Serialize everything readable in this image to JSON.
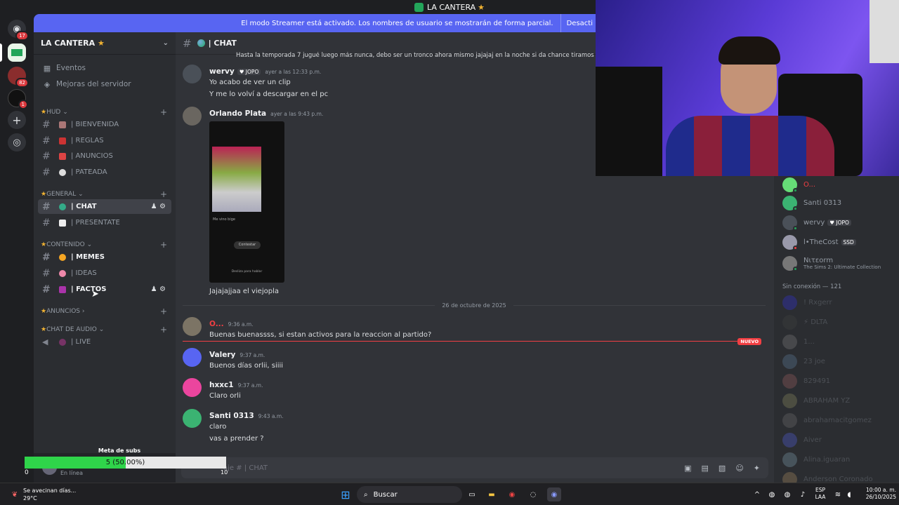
{
  "titlebar": {
    "title": "LA CANTERA",
    "star": "★"
  },
  "rail": {
    "badges": [
      "17",
      "82",
      "1"
    ],
    "add_icon": "+",
    "explore_icon": "compass-icon"
  },
  "banner": {
    "text": "El modo Streamer está activado. Los nombres de usuario se mostrarán de forma parcial.",
    "button": "Desacti"
  },
  "sidebar": {
    "server_name": "LA CANTERA",
    "server_star": "★",
    "events": "Eventos",
    "boosts": "Mejoras del servidor",
    "categories": [
      {
        "name": "HUD",
        "channels": [
          "| BIENVENIDA",
          "| REGLAS",
          "| ANUNCIOS",
          "| PATEADA"
        ]
      },
      {
        "name": "GENERAL",
        "channels": [
          "| CHAT",
          "| PRESENTATE"
        ]
      },
      {
        "name": "CONTENIDO",
        "channels": [
          "| MEMES",
          "| IDEAS",
          "| FACTOS"
        ]
      },
      {
        "name": "ANUNCIOS",
        "channels": []
      },
      {
        "name": "CHAT DE AUDIO",
        "channels": [
          "| LIVE"
        ]
      }
    ],
    "user_status": "En línea"
  },
  "chat": {
    "channel": "| CHAT",
    "top_line": "Hasta la temporada 7 jugué luego más nunca, debo ser un tronco ahora mismo jajajaj en la noche si da chance tiramos fortnite tam",
    "messages": [
      {
        "user": "wervy",
        "tag": "♥ JOPO",
        "time": "ayer a las 12:33 p.m.",
        "lines": [
          "Yo acabo de ver un clip",
          "Y me lo volví a descargar en el pc"
        ]
      },
      {
        "user": "Orlando Plata",
        "time": "ayer a las 9:43 p.m.",
        "lines": [
          "Jajajajjaa el viejopla"
        ]
      },
      {
        "user": "O...",
        "time": "9:36 a.m.",
        "lines": [
          "Buenas buenassss, si estan activos para la reaccion al partido?"
        ]
      },
      {
        "user": "Valery",
        "time": "9:37 a.m.",
        "lines": [
          "Buenos días orlii, siiii"
        ]
      },
      {
        "user": "hxxc1",
        "time": "9:37 a.m.",
        "lines": [
          "Claro orli"
        ]
      },
      {
        "user": "Santi 0313",
        "time": "9:43 a.m.",
        "lines": [
          "claro",
          "vas a prender ?"
        ]
      }
    ],
    "date_divider": "26 de octubre de 2025",
    "new_tag": "NUEVO",
    "composer_placeholder": "aje #  | CHAT",
    "phone_caption": "Me vino bige",
    "phone_button": "Contestar",
    "phone_footer": "Desliza para hablar"
  },
  "members": {
    "online": [
      {
        "name": "O...",
        "extra": ""
      },
      {
        "name": "Santi 0313",
        "extra": ""
      },
      {
        "name": "wervy",
        "extra": "♥ JOPO"
      },
      {
        "name": "l•TheCost",
        "extra": "SSD"
      },
      {
        "name": "Nιτεorm",
        "extra": "The Sims 2: Ultimate Collection"
      }
    ],
    "offline_header": "Sin conexión — 121",
    "offline": [
      "! Rxgerr",
      "⚡ DLTA",
      "1...",
      "23 joe",
      "829491",
      "ABRAHAM YZ",
      "abrahamacitgomez",
      "Aiver",
      "Alina.iguaran",
      "Anderson Coronado"
    ]
  },
  "overlay": {
    "goal_label": "Meta de subs",
    "goal_text": "5 (50.00%)",
    "goal_fraction": 0.5,
    "start": "0",
    "end": "10"
  },
  "taskbar": {
    "weather_title": "Se avecinan días...",
    "weather_temp": "29°C",
    "search": "Buscar",
    "lang1": "ESP",
    "lang2": "LAA",
    "time": "10:00 a. m.",
    "date": "26/10/2025"
  }
}
